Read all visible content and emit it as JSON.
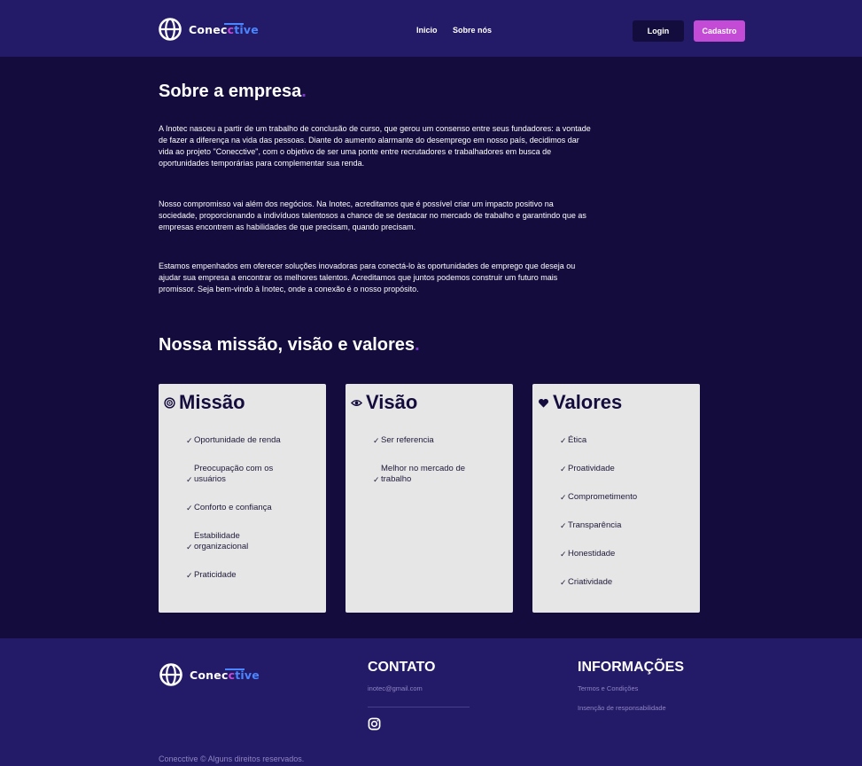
{
  "header": {
    "logo": {
      "part1": "Conec",
      "part2": "c",
      "part3": "tive",
      "icon": "globe-icon"
    },
    "nav": [
      {
        "label": "Inicio"
      },
      {
        "label": "Sobre nós"
      }
    ],
    "login_label": "Login",
    "cadastro_label": "Cadastro"
  },
  "about": {
    "title": "Sobre a empresa",
    "title_dot": ".",
    "paragraphs": [
      "A Inotec nasceu a partir de um trabalho de conclusão de curso, que gerou um consenso entre seus fundadores: a vontade de fazer a diferença na vida das pessoas. Diante do aumento alarmante do desemprego em nosso país, decidimos dar vida ao projeto \"Conecctive\", com o objetivo de ser uma ponte entre recrutadores e trabalhadores em busca de oportunidades temporárias para complementar sua renda.",
      "Nosso compromisso vai além dos negócios. Na Inotec, acreditamos que é possível criar um impacto positivo na sociedade, proporcionando a indivíduos talentosos a chance de se destacar no mercado de trabalho e garantindo que as empresas encontrem as habilidades de que precisam, quando precisam.",
      "Estamos empenhados em oferecer soluções inovadoras para conectá-lo às oportunidades de emprego que deseja ou ajudar sua empresa a encontrar os melhores talentos. Acreditamos que juntos podemos construir um futuro mais promissor. Seja bem-vindo à Inotec, onde a conexão é o nosso propósito."
    ]
  },
  "mission": {
    "title": "Nossa missão, visão e valores",
    "title_dot": ".",
    "check_glyph": "✓",
    "cards": [
      {
        "title": "Missão",
        "icon": "target-icon",
        "items": [
          "Oportunidade de renda",
          "Preocupação com os usuários",
          "Conforto e confiança",
          "Estabilidade organizacional",
          "Praticidade"
        ]
      },
      {
        "title": "Visão",
        "icon": "eye-icon",
        "items": [
          "Ser referencia",
          "Melhor no mercado de trabalho"
        ]
      },
      {
        "title": "Valores",
        "icon": "heart-icon",
        "items": [
          "Ética",
          "Proatividade",
          "Comprometimento",
          "Transparência",
          "Honestidade",
          "Criatividade"
        ]
      }
    ]
  },
  "footer": {
    "contato_title": "CONTATO",
    "email": "inotec@gmail.com",
    "social_icon": "instagram-icon",
    "info_title": "INFORMAÇÕES",
    "links": [
      "Termos e Condições",
      "Insenção de responsabilidade"
    ],
    "copyright": "Conecctive © Alguns direitos reservados."
  },
  "colors": {
    "background": "#140c3d",
    "header_footer": "#231a68",
    "accent_purple": "#c44bd6",
    "accent_blue": "#4b86ff",
    "card": "#e6e6e6"
  }
}
